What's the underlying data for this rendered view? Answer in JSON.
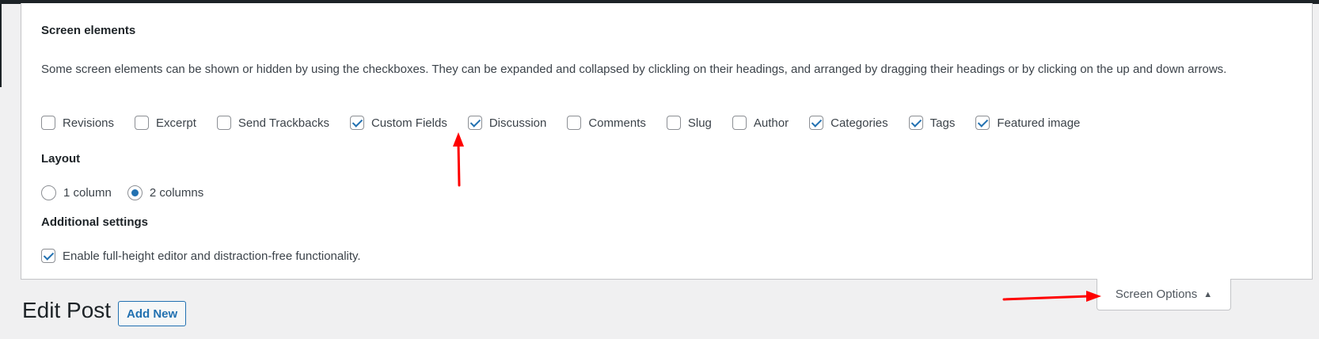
{
  "screen_elements": {
    "title": "Screen elements",
    "description": "Some screen elements can be shown or hidden by using the checkboxes. They can be expanded and collapsed by clickling on their headings, and arranged by dragging their headings or by clicking on the up and down arrows.",
    "checkboxes": [
      {
        "label": "Revisions",
        "checked": false
      },
      {
        "label": "Excerpt",
        "checked": false
      },
      {
        "label": "Send Trackbacks",
        "checked": false
      },
      {
        "label": "Custom Fields",
        "checked": true
      },
      {
        "label": "Discussion",
        "checked": true
      },
      {
        "label": "Comments",
        "checked": false
      },
      {
        "label": "Slug",
        "checked": false
      },
      {
        "label": "Author",
        "checked": false
      },
      {
        "label": "Categories",
        "checked": true
      },
      {
        "label": "Tags",
        "checked": true
      },
      {
        "label": "Featured image",
        "checked": true
      }
    ]
  },
  "layout": {
    "title": "Layout",
    "options": [
      {
        "label": "1 column",
        "checked": false
      },
      {
        "label": "2 columns",
        "checked": true
      }
    ]
  },
  "additional": {
    "title": "Additional settings",
    "option": {
      "label": "Enable full-height editor and distraction-free functionality.",
      "checked": true
    }
  },
  "screen_options_tab": {
    "label": "Screen Options",
    "icon": "triangle-up-icon"
  },
  "page": {
    "title": "Edit Post",
    "add_new_label": "Add New"
  },
  "colors": {
    "accent": "#2271b1",
    "annotation": "#ff0000"
  }
}
